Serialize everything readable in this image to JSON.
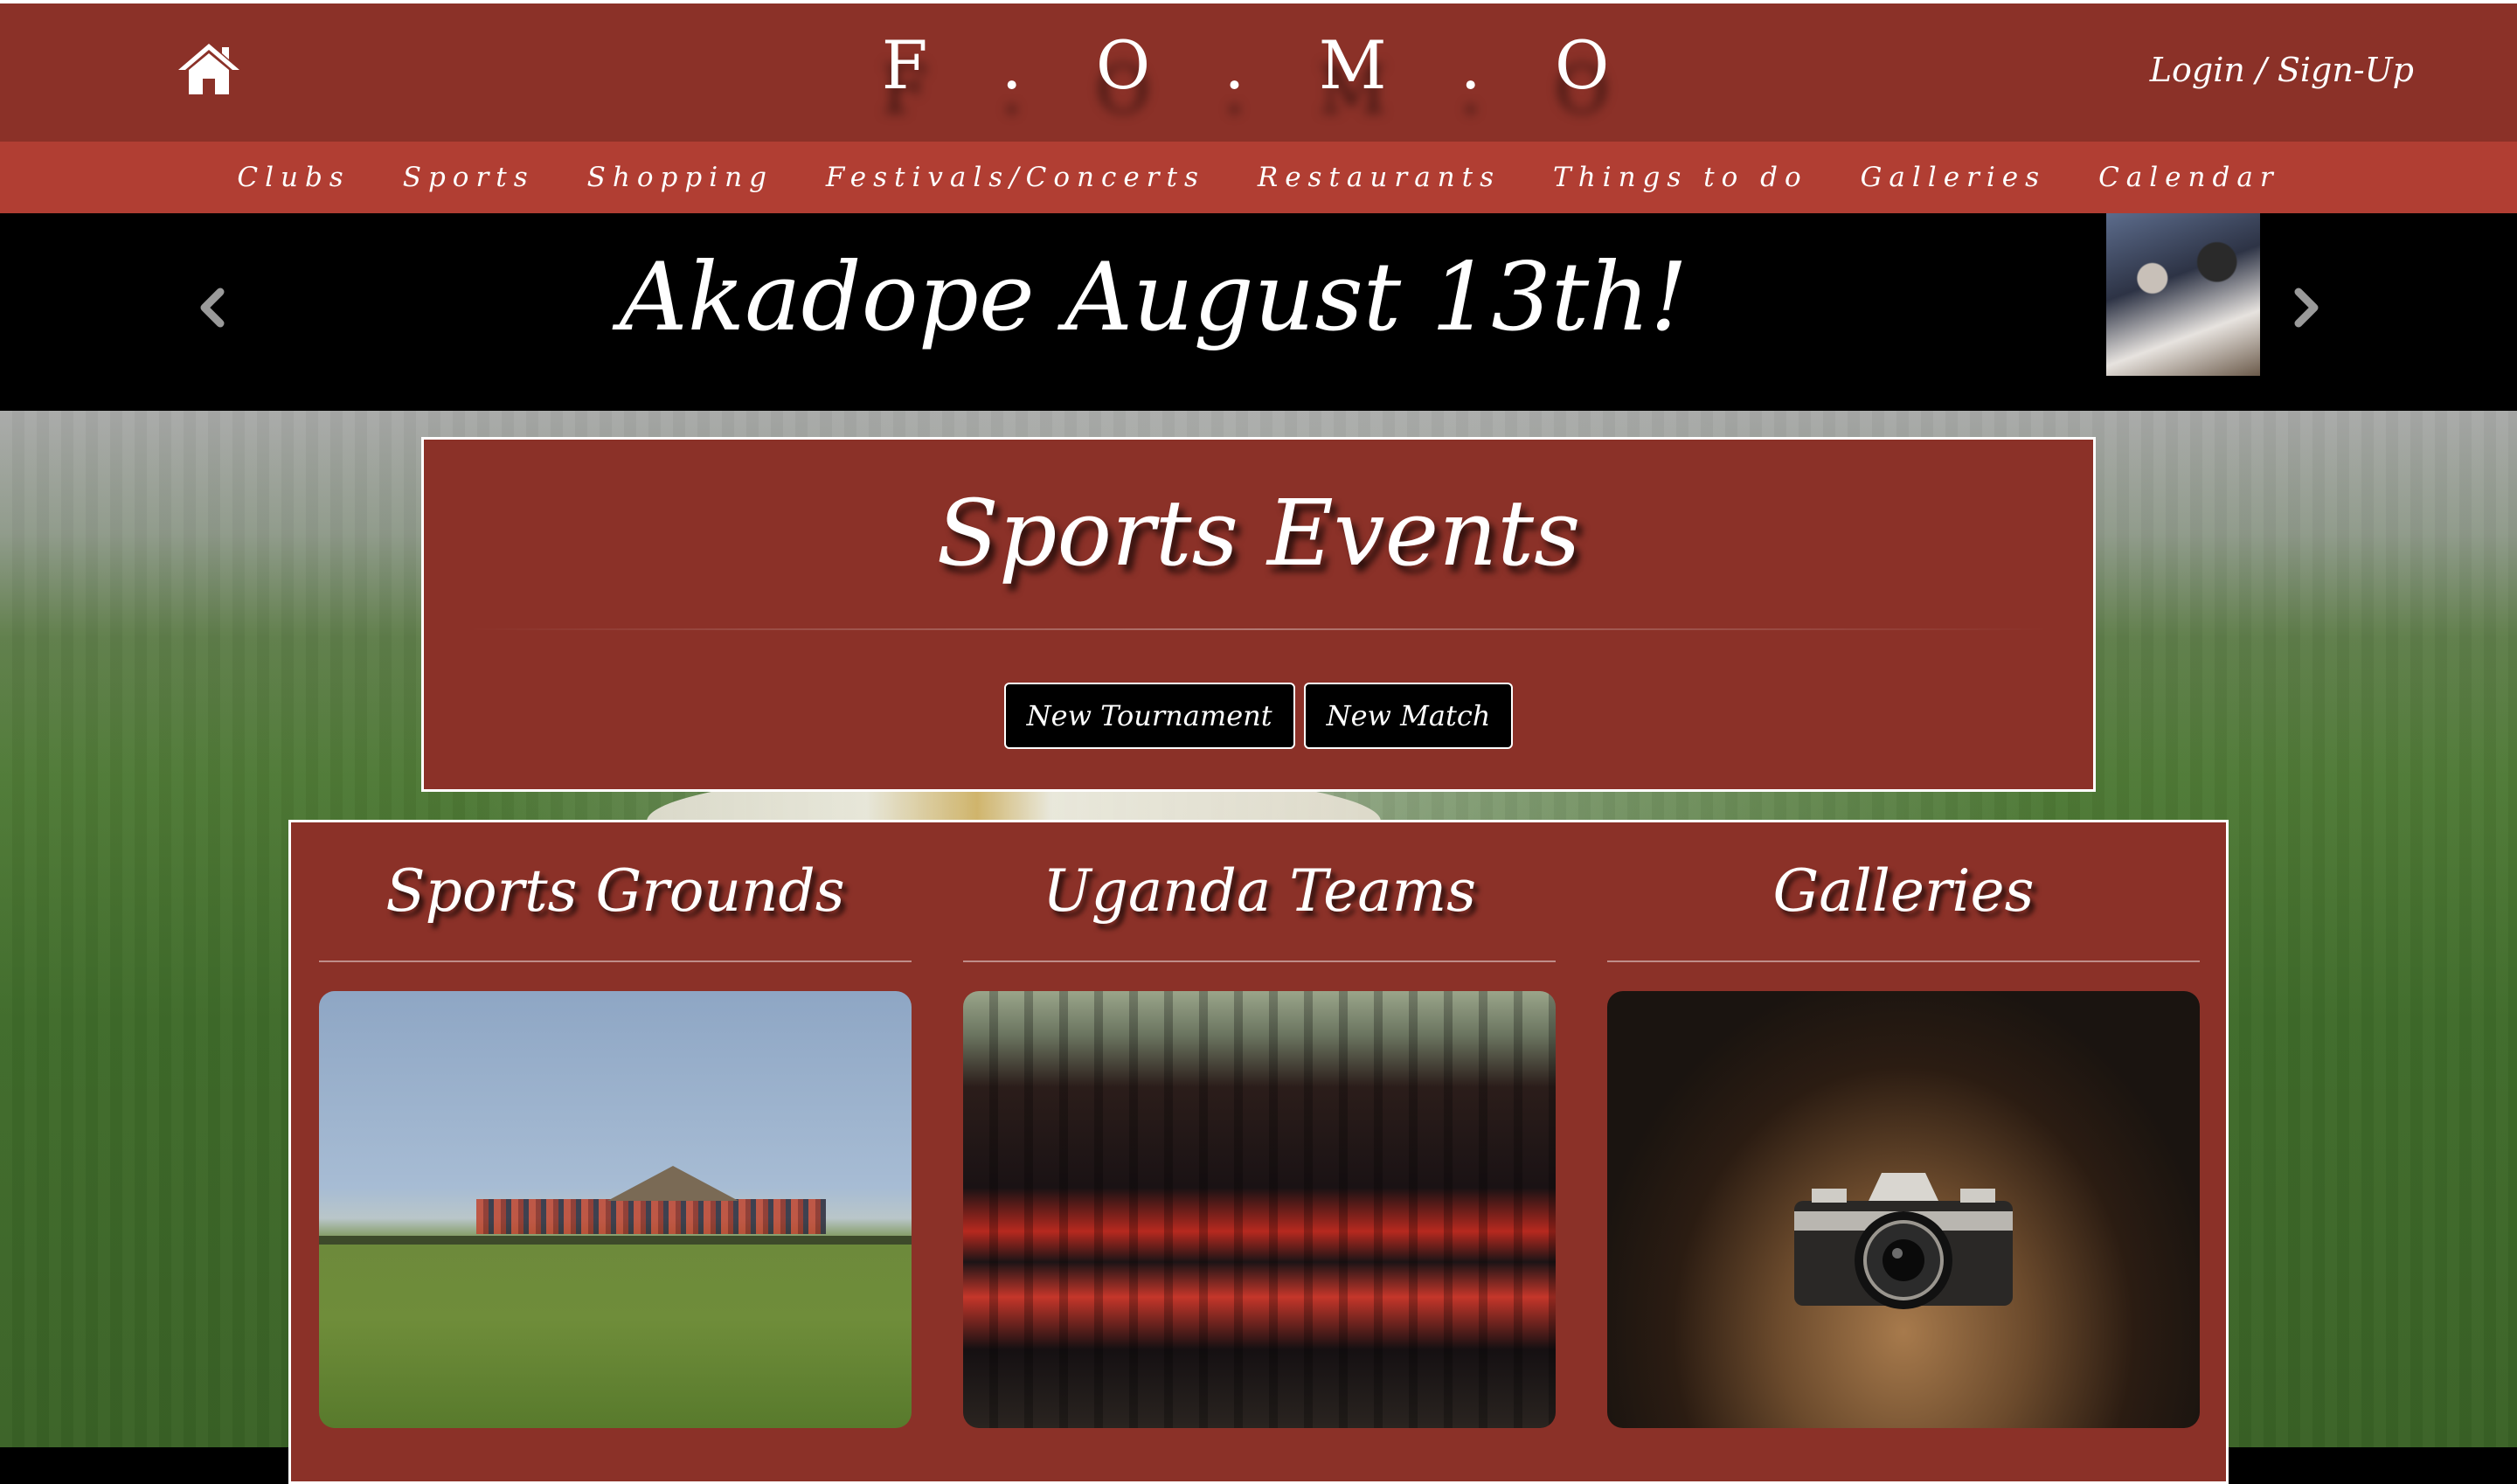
{
  "header": {
    "brand": "F . O . M . O",
    "login_label": "Login / Sign-Up"
  },
  "nav": {
    "items": [
      "Clubs",
      "Sports",
      "Shopping",
      "Festivals/Concerts",
      "Restaurants",
      "Things to do",
      "Galleries",
      "Calendar"
    ]
  },
  "carousel": {
    "caption": "Akadope August 13th!"
  },
  "events": {
    "title": "Sports Events",
    "new_tournament_label": "New Tournament",
    "new_match_label": "New Match"
  },
  "categories": [
    {
      "title": "Sports Grounds"
    },
    {
      "title": "Uganda Teams"
    },
    {
      "title": "Galleries"
    }
  ],
  "icons": {
    "home": "home-icon",
    "prev": "chevron-left-icon",
    "next": "chevron-right-icon",
    "camera": "camera-image"
  },
  "colors": {
    "header_bg": "#8b3128",
    "nav_bg": "#b13e33",
    "carousel_bg": "#000000",
    "button_bg": "#000000",
    "text": "#ffffff"
  }
}
